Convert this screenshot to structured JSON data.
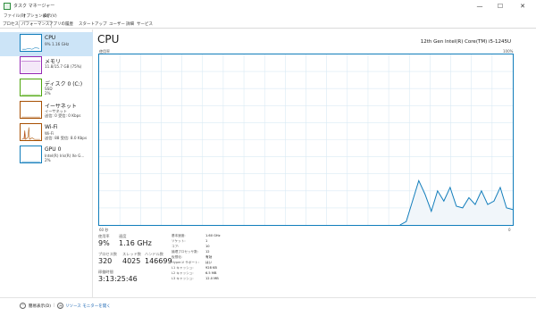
{
  "window": {
    "title": "タスク マネージャー",
    "min": "—",
    "max": "☐",
    "close": "✕"
  },
  "menu": [
    "ファイル(F)",
    "オプション(O)",
    "表示(V)"
  ],
  "tabs": [
    "プロセス",
    "パフォーマンス",
    "アプリの履歴",
    "スタートアップ",
    "ユーザー",
    "詳細",
    "サービス"
  ],
  "active_tab": "パフォーマンス",
  "sidebar": {
    "items": [
      {
        "title": "CPU",
        "sub1": "9%  1.16 GHz",
        "sub2": "",
        "icon": "cpu-graph-icon"
      },
      {
        "title": "メモリ",
        "sub1": "11.8/15.7 GB (75%)",
        "sub2": "",
        "icon": "memory-graph-icon"
      },
      {
        "title": "ディスク 0 (C:)",
        "sub1": "SSD",
        "sub2": "2%",
        "icon": "disk-graph-icon"
      },
      {
        "title": "イーサネット",
        "sub1": "イーサネット",
        "sub2": "送信: 0 受信: 0 Kbps",
        "icon": "ethernet-graph-icon"
      },
      {
        "title": "Wi-Fi",
        "sub1": "Wi-Fi",
        "sub2": "送信: 88 受信: 8.0 Kbps",
        "icon": "wifi-graph-icon"
      },
      {
        "title": "GPU 0",
        "sub1": "Intel(R) Iris(R) Xe G...",
        "sub2": "2%",
        "icon": "gpu-graph-icon"
      }
    ]
  },
  "main": {
    "title": "CPU",
    "model": "12th Gen Intel(R) Core(TM) i5-1245U",
    "util_label": "使用率",
    "max_pct": "100%",
    "seconds_label": "60 秒",
    "zero_label": "0",
    "colors": {
      "graph_border": "#117dbb",
      "graph_line": "#117dbb",
      "graph_fill": "#f1f6fa",
      "grid": "#d9eaf4"
    }
  },
  "cpu_history": [
    0,
    0,
    0,
    0,
    0,
    0,
    0,
    0,
    0,
    0,
    0,
    0,
    0,
    0,
    0,
    0,
    0,
    0,
    0,
    0,
    0,
    0,
    0,
    0,
    0,
    0,
    0,
    0,
    0,
    0,
    0,
    0,
    0,
    0,
    0,
    0,
    0,
    0,
    0,
    0,
    0,
    0,
    0,
    0,
    0,
    0,
    0,
    0,
    0,
    2,
    14,
    26,
    18,
    8,
    20,
    14,
    22,
    11,
    10,
    16,
    12,
    20,
    12,
    14,
    22,
    10,
    9
  ],
  "stats": {
    "usage_label": "使用率",
    "usage_value": "9%",
    "speed_label": "速度",
    "speed_value": "1.16 GHz",
    "processes_label": "プロセス数",
    "processes_value": "320",
    "threads_label": "スレッド数",
    "threads_value": "4025",
    "handles_label": "ハンドル数",
    "handles_value": "146699",
    "uptime_label": "稼働時間",
    "uptime_value": "3:13:25:46"
  },
  "specs": [
    {
      "k": "基本速度:",
      "v": "1.60 GHz"
    },
    {
      "k": "ソケット:",
      "v": "1"
    },
    {
      "k": "コア:",
      "v": "10"
    },
    {
      "k": "論理プロセッサ数:",
      "v": "12"
    },
    {
      "k": "仮想化:",
      "v": "有効"
    },
    {
      "k": "Hyper-V サポート:",
      "v": "はい"
    },
    {
      "k": "L1 キャッシュ:",
      "v": "928 KB"
    },
    {
      "k": "L2 キャッシュ:",
      "v": "6.5 MB"
    },
    {
      "k": "L3 キャッシュ:",
      "v": "12.0 MB"
    }
  ],
  "footer": {
    "brief_label": "簡易表示(D)",
    "monitor_label": "リソース モニターを開く"
  }
}
